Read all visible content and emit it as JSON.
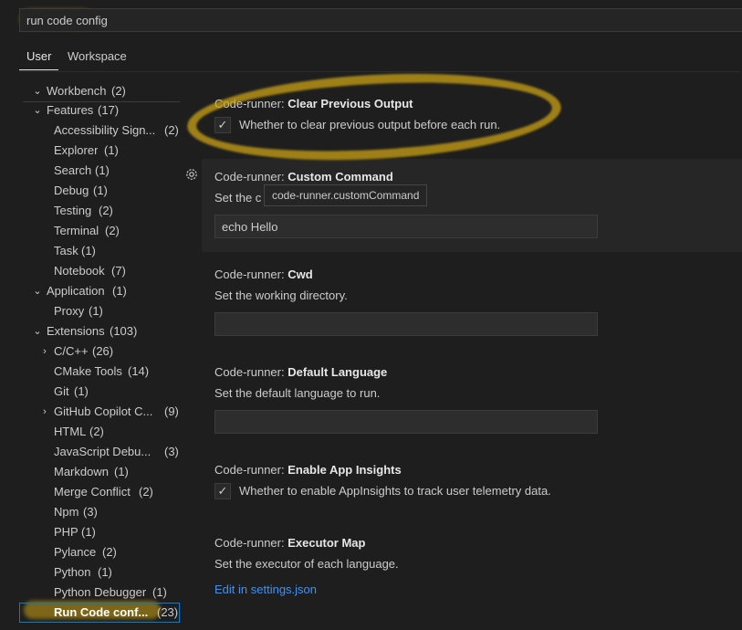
{
  "search": {
    "value": "run code config"
  },
  "tabs": [
    {
      "label": "User"
    },
    {
      "label": "Workspace"
    }
  ],
  "toc": [
    {
      "label": "Workbench",
      "count": "(2)"
    },
    {
      "label": "Features",
      "count": "(17)"
    },
    {
      "label": "Accessibility Sign...",
      "count": "(2)"
    },
    {
      "label": "Explorer",
      "count": "(1)"
    },
    {
      "label": "Search",
      "count": "(1)"
    },
    {
      "label": "Debug",
      "count": "(1)"
    },
    {
      "label": "Testing",
      "count": "(2)"
    },
    {
      "label": "Terminal",
      "count": "(2)"
    },
    {
      "label": "Task",
      "count": "(1)"
    },
    {
      "label": "Notebook",
      "count": "(7)"
    },
    {
      "label": "Application",
      "count": "(1)"
    },
    {
      "label": "Proxy",
      "count": "(1)"
    },
    {
      "label": "Extensions",
      "count": "(103)"
    },
    {
      "label": "C/C++",
      "count": "(26)"
    },
    {
      "label": "CMake Tools",
      "count": "(14)"
    },
    {
      "label": "Git",
      "count": "(1)"
    },
    {
      "label": "GitHub Copilot C...",
      "count": "(9)"
    },
    {
      "label": "HTML",
      "count": "(2)"
    },
    {
      "label": "JavaScript Debu...",
      "count": "(3)"
    },
    {
      "label": "Markdown",
      "count": "(1)"
    },
    {
      "label": "Merge Conflict",
      "count": "(2)"
    },
    {
      "label": "Npm",
      "count": "(3)"
    },
    {
      "label": "PHP",
      "count": "(1)"
    },
    {
      "label": "Pylance",
      "count": "(2)"
    },
    {
      "label": "Python",
      "count": "(1)"
    },
    {
      "label": "Python Debugger",
      "count": "(1)"
    },
    {
      "label": "Run Code conf...",
      "count": "(23)"
    }
  ],
  "settings": {
    "clear_output": {
      "prefix": "Code-runner: ",
      "name": "Clear Previous Output",
      "desc": "Whether to clear previous output before each run.",
      "checked": true
    },
    "custom_command": {
      "prefix": "Code-runner: ",
      "name": "Custom Command",
      "desc": "Set the c",
      "value": "echo Hello",
      "tooltip": "code-runner.customCommand"
    },
    "cwd": {
      "prefix": "Code-runner: ",
      "name": "Cwd",
      "desc": "Set the working directory.",
      "value": ""
    },
    "default_language": {
      "prefix": "Code-runner: ",
      "name": "Default Language",
      "desc": "Set the default language to run.",
      "value": ""
    },
    "app_insights": {
      "prefix": "Code-runner: ",
      "name": "Enable App Insights",
      "desc": "Whether to enable AppInsights to track user telemetry data.",
      "checked": true
    },
    "executor_map": {
      "prefix": "Code-runner: ",
      "name": "Executor Map",
      "desc": "Set the executor of each language.",
      "link": "Edit in settings.json"
    }
  },
  "icons": {
    "gear": "gear-icon",
    "check": "check-icon",
    "chevron_down": "chevron-down-icon",
    "chevron_right": "chevron-right-icon"
  },
  "colors": {
    "background": "#1e1e1e",
    "link": "#3794ff",
    "focus_border": "#007fd4",
    "highlighter": "#c8a014"
  }
}
